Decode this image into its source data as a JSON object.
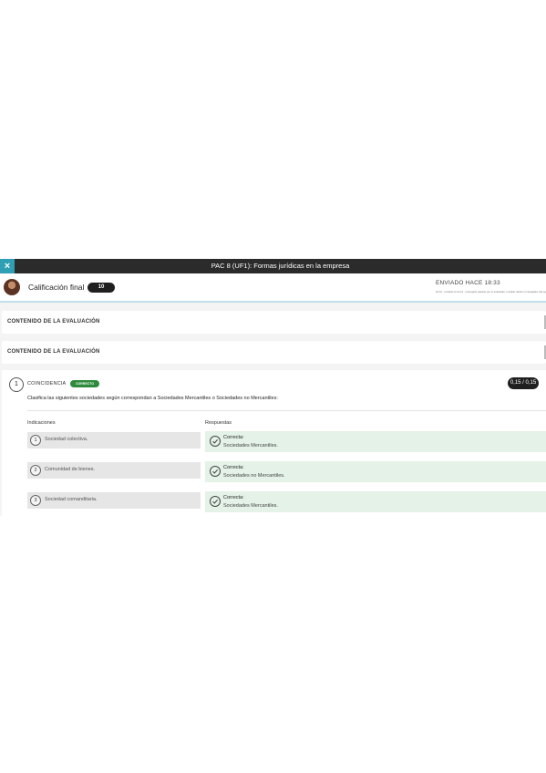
{
  "window": {
    "close_symbol": "×",
    "title": "PAC 8 (UF1): Formas jurídicas en la empresa"
  },
  "header": {
    "final_grade_label": "Calificación final",
    "final_grade_value": "10",
    "sent_title": "ENVIADO HACE 18:33",
    "sent_subtitle": "16:10 · enviado el 14-12 · entregado pasado por el evaluador, enviado desde el navegador del equipo"
  },
  "sections": [
    {
      "title": "CONTENIDO DE LA EVALUACIÓN"
    },
    {
      "title": "CONTENIDO DE LA EVALUACIÓN"
    }
  ],
  "question": {
    "number": "1",
    "type": "COINCIDENCIA",
    "badge": "CORRECTO",
    "score": "0,15 / 0,15",
    "statement": "Clasifica las siguientes sociedades según correspondan a Sociedades Mercantiles o Sociedades no Mercantiles:",
    "indications_header": "Indicaciones",
    "answers_header": "Respuestas",
    "rows": [
      {
        "number": "1",
        "indication": "Sociedad colectiva.",
        "status": "Correcta:",
        "answer": "Sociedades Mercantiles."
      },
      {
        "number": "2",
        "indication": "Comunidad de bienes.",
        "status": "Correcta:",
        "answer": "Sociedades no Mercantiles."
      },
      {
        "number": "3",
        "indication": "Sociedad comanditaria.",
        "status": "Correcta:",
        "answer": "Sociedades Mercantiles."
      }
    ]
  },
  "colors": {
    "topbar": "#2b2b2b",
    "close_button": "#2f9fb3",
    "badge_correct": "#2e8b3d",
    "answer_bg": "#e4f2e7",
    "indication_bg": "#e6e6e6"
  },
  "icons": {
    "close": "close-icon",
    "check": "check-circle-icon"
  }
}
